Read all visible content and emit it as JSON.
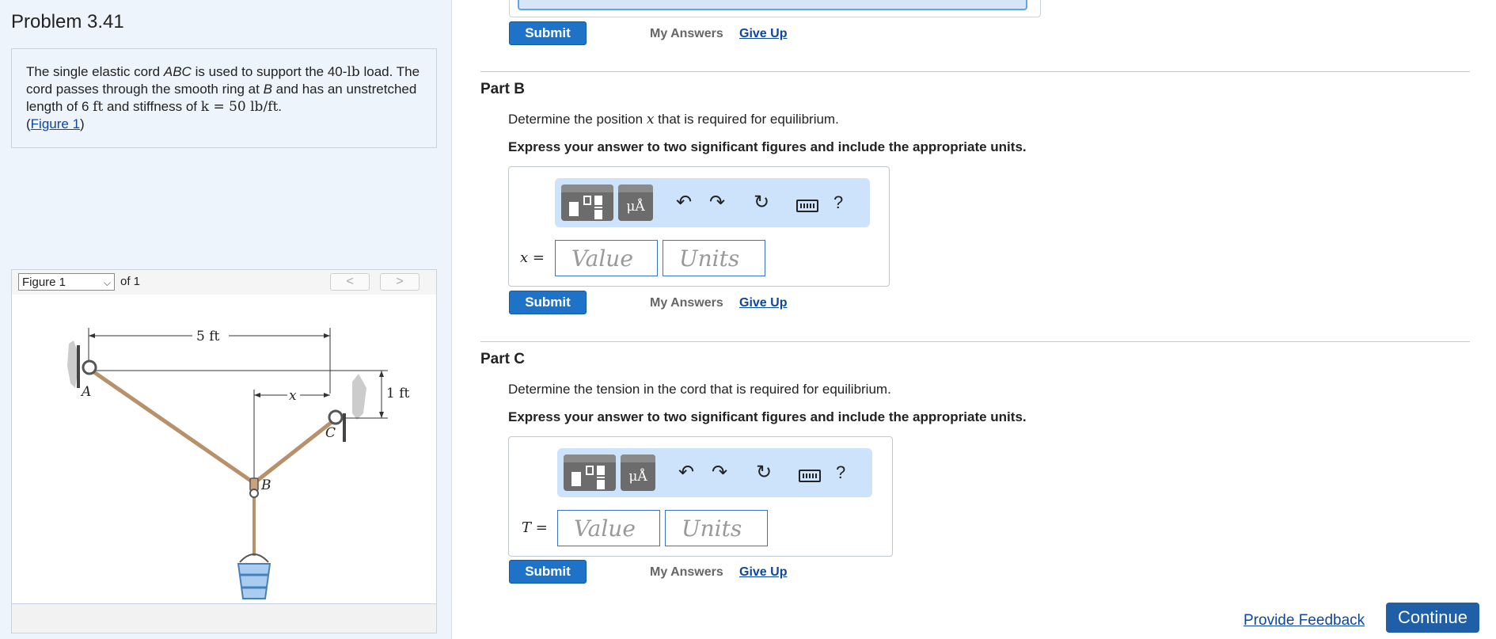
{
  "problem": {
    "title": "Problem 3.41",
    "text_1": "The single elastic cord ",
    "text_abc": "ABC",
    "text_2": " is used to support the 40-",
    "unit_lb": "lb",
    "text_3": " load. The cord passes through the smooth ring at ",
    "text_b": "B",
    "text_4": " and has an unstretched length of 6 ",
    "unit_ft": "ft",
    "text_5": " and stiffness of ",
    "k_expr": "k = 50 lb/ft",
    "text_6": ".",
    "figure_link_open": "(",
    "figure_link": "Figure 1",
    "figure_link_close": ")"
  },
  "figure": {
    "select_value": "Figure 1",
    "of_label": "of 1",
    "prev": "<",
    "next": ">",
    "dim_5ft": "5 ft",
    "dim_1ft": "1 ft",
    "dim_x": "x",
    "label_a": "A",
    "label_b": "B",
    "label_c": "C"
  },
  "partA": {
    "submit": "Submit",
    "my_answers": "My Answers",
    "give_up": "Give Up"
  },
  "partB": {
    "title": "Part B",
    "prompt_1": "Determine the position ",
    "prompt_var": "x",
    "prompt_2": " that is required for equilibrium.",
    "instruction": "Express your answer to two significant figures and include the appropriate units.",
    "var_label": "x",
    "eq": " =",
    "value_placeholder": "Value",
    "units_placeholder": "Units",
    "units_button": "μÅ",
    "help": "?",
    "submit": "Submit",
    "my_answers": "My Answers",
    "give_up": "Give Up"
  },
  "partC": {
    "title": "Part C",
    "prompt": "Determine the tension in the cord that is required for equilibrium.",
    "instruction": "Express your answer to two significant figures and include the appropriate units.",
    "var_label": "T",
    "eq": " =",
    "value_placeholder": "Value",
    "units_placeholder": "Units",
    "units_button": "μÅ",
    "help": "?",
    "submit": "Submit",
    "my_answers": "My Answers",
    "give_up": "Give Up"
  },
  "footer": {
    "feedback": "Provide Feedback",
    "continue": "Continue"
  }
}
